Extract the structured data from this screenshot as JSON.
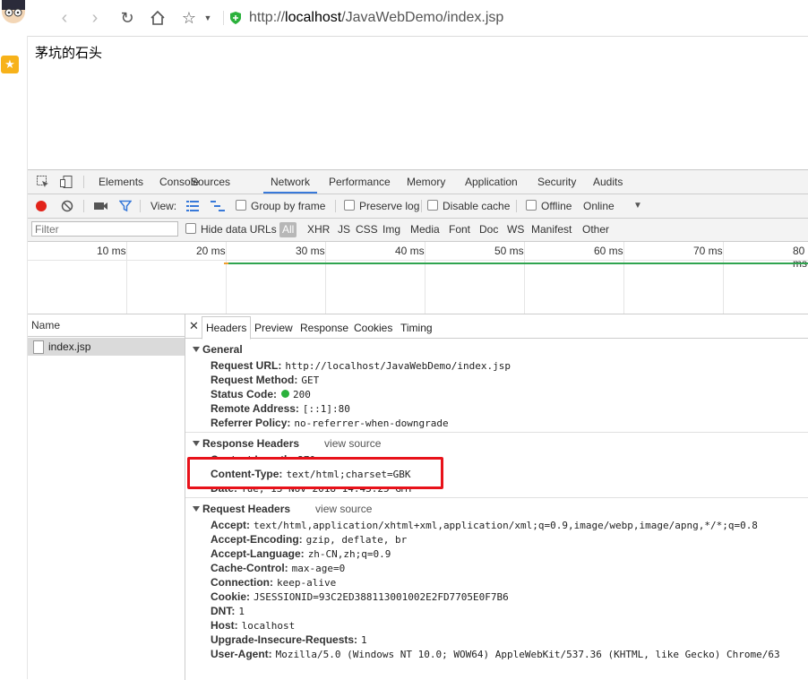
{
  "browser": {
    "url_prefix": "http://",
    "url_host": "localhost",
    "url_path": "/JavaWebDemo/index.jsp"
  },
  "page": {
    "text": "茅坑的石头"
  },
  "devtools": {
    "tabs": [
      "Elements",
      "Console",
      "Sources",
      "Network",
      "Performance",
      "Memory",
      "Application",
      "Security",
      "Audits"
    ],
    "active_tab": "Network",
    "toolbar": {
      "view_label": "View:",
      "group_by_frame": "Group by frame",
      "preserve_log": "Preserve log",
      "disable_cache": "Disable cache",
      "offline": "Offline",
      "throttle": "Online"
    },
    "filter": {
      "placeholder": "Filter",
      "hide_data_urls": "Hide data URLs",
      "types": [
        "All",
        "XHR",
        "JS",
        "CSS",
        "Img",
        "Media",
        "Font",
        "Doc",
        "WS",
        "Manifest",
        "Other"
      ]
    },
    "timeline_ticks": [
      "10 ms",
      "20 ms",
      "30 ms",
      "40 ms",
      "50 ms",
      "60 ms",
      "70 ms",
      "80 ms"
    ],
    "name_header": "Name",
    "requests": [
      "index.jsp"
    ],
    "detail_tabs": [
      "Headers",
      "Preview",
      "Response",
      "Cookies",
      "Timing"
    ],
    "general": {
      "title": "General",
      "rows": [
        {
          "k": "Request URL:",
          "v": "http://localhost/JavaWebDemo/index.jsp"
        },
        {
          "k": "Request Method:",
          "v": "GET"
        },
        {
          "k": "Status Code:",
          "v": "200"
        },
        {
          "k": "Remote Address:",
          "v": "[::1]:80"
        },
        {
          "k": "Referrer Policy:",
          "v": "no-referrer-when-downgrade"
        }
      ]
    },
    "response_headers": {
      "title": "Response Headers",
      "view_source": "view source",
      "rows": [
        {
          "k": "Content-Length:",
          "v": "270"
        },
        {
          "k": "Content-Type:",
          "v": "text/html;charset=GBK"
        },
        {
          "k": "Date:",
          "v": "Tue, 13 Nov 2018 14:43:25 GMT"
        }
      ]
    },
    "request_headers": {
      "title": "Request Headers",
      "view_source": "view source",
      "rows": [
        {
          "k": "Accept:",
          "v": "text/html,application/xhtml+xml,application/xml;q=0.9,image/webp,image/apng,*/*;q=0.8"
        },
        {
          "k": "Accept-Encoding:",
          "v": "gzip, deflate, br"
        },
        {
          "k": "Accept-Language:",
          "v": "zh-CN,zh;q=0.9"
        },
        {
          "k": "Cache-Control:",
          "v": "max-age=0"
        },
        {
          "k": "Connection:",
          "v": "keep-alive"
        },
        {
          "k": "Cookie:",
          "v": "JSESSIONID=93C2ED388113001002E2FD7705E0F7B6"
        },
        {
          "k": "DNT:",
          "v": "1"
        },
        {
          "k": "Host:",
          "v": "localhost"
        },
        {
          "k": "Upgrade-Insecure-Requests:",
          "v": "1"
        },
        {
          "k": "User-Agent:",
          "v": "Mozilla/5.0 (Windows NT 10.0; WOW64) AppleWebKit/537.36 (KHTML, like Gecko) Chrome/63"
        }
      ]
    },
    "colors": {
      "accent": "#3879d9",
      "record": "#e2231a",
      "status_ok": "#2bb13c",
      "highlight_box": "#e8121a",
      "star": "#f7b21a",
      "waterfall": "#2fa44f"
    }
  }
}
